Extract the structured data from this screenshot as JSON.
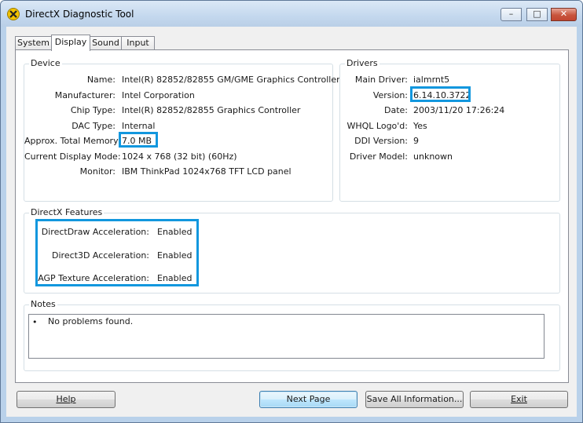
{
  "window": {
    "title": "DirectX Diagnostic Tool",
    "icon": "directx-icon",
    "controls": {
      "minimize": "minimize-icon",
      "maximize": "maximize-icon",
      "close": "close-icon"
    }
  },
  "tabs": [
    {
      "label": "System",
      "active": false
    },
    {
      "label": "Display",
      "active": true
    },
    {
      "label": "Sound",
      "active": false
    },
    {
      "label": "Input",
      "active": false
    }
  ],
  "device": {
    "title": "Device",
    "rows": [
      {
        "label": "Name:",
        "value": "Intel(R) 82852/82855 GM/GME Graphics Controller"
      },
      {
        "label": "Manufacturer:",
        "value": "Intel Corporation"
      },
      {
        "label": "Chip Type:",
        "value": "Intel(R) 82852/82855 Graphics Controller"
      },
      {
        "label": "DAC Type:",
        "value": "Internal"
      },
      {
        "label": "Approx. Total Memory:",
        "value": "7.0 MB"
      },
      {
        "label": "Current Display Mode:",
        "value": "1024 x 768 (32 bit) (60Hz)"
      },
      {
        "label": "Monitor:",
        "value": "IBM ThinkPad 1024x768 TFT LCD panel"
      }
    ]
  },
  "drivers": {
    "title": "Drivers",
    "rows": [
      {
        "label": "Main Driver:",
        "value": "ialmrnt5"
      },
      {
        "label": "Version:",
        "value": "6.14.10.3722"
      },
      {
        "label": "Date:",
        "value": "2003/11/20 17:26:24"
      },
      {
        "label": "WHQL Logo'd:",
        "value": "Yes"
      },
      {
        "label": "DDI Version:",
        "value": "9"
      },
      {
        "label": "Driver Model:",
        "value": "unknown"
      }
    ]
  },
  "features": {
    "title": "DirectX Features",
    "rows": [
      {
        "label": "DirectDraw Acceleration:",
        "value": "Enabled"
      },
      {
        "label": "Direct3D Acceleration:",
        "value": "Enabled"
      },
      {
        "label": "AGP Texture Acceleration:",
        "value": "Enabled"
      }
    ]
  },
  "notes": {
    "title": "Notes",
    "bullet": "•",
    "text": "No problems found."
  },
  "buttons": {
    "help": "Help",
    "next_page": "Next Page",
    "save_all": "Save All Information...",
    "exit": "Exit"
  },
  "colors": {
    "highlight": "#1297de",
    "titlebar": "#c4d8ee",
    "dialog": "#f0f0f0"
  }
}
